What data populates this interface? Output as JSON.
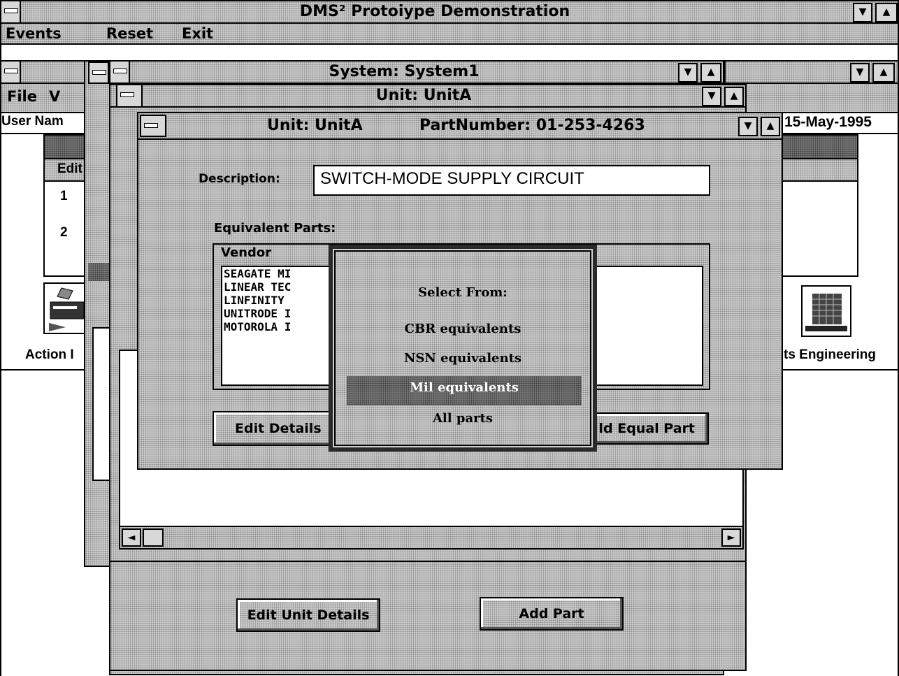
{
  "main_window": {
    "title": "DMS² Protoiype Demonstration"
  },
  "menubar": {
    "items": [
      "Events",
      "Reset",
      "Exit"
    ]
  },
  "system_window": {
    "title": "System: System1"
  },
  "system_menubar": {
    "items": [
      "File",
      "V"
    ]
  },
  "info_row": {
    "user_name_label": "User Nam",
    "date": "15-May-1995"
  },
  "left_table": {
    "header": "Edit",
    "rows": [
      "1",
      "2"
    ]
  },
  "icons": {
    "left_label": "Action I",
    "right_label": "ts Engineering"
  },
  "unit_window": {
    "title": "Unit: UnitA"
  },
  "unit_buttons": {
    "edit_label": "Edit Unit Details",
    "add_label": "Add Part"
  },
  "part_window": {
    "title_unit": "Unit: UnitA",
    "title_part": "PartNumber: 01-253-4263",
    "description_label": "Description:",
    "description_value": "SWITCH-MODE SUPPLY CIRCUIT",
    "equivalent_label": "Equivalent Parts:",
    "vendor_header": "Vendor",
    "vendors": [
      "SEAGATE MI",
      "LINEAR TEC",
      "LINFINITY",
      "UNITRODE I",
      "MOTOROLA I"
    ],
    "edit_details_label": "Edit Details",
    "add_equal_label": "ld Equal Part"
  },
  "popup": {
    "heading": "Select From:",
    "options": [
      "CBR equivalents",
      "NSN equivalents",
      "Mil equivalents",
      "All parts"
    ],
    "selected_index": 2
  }
}
